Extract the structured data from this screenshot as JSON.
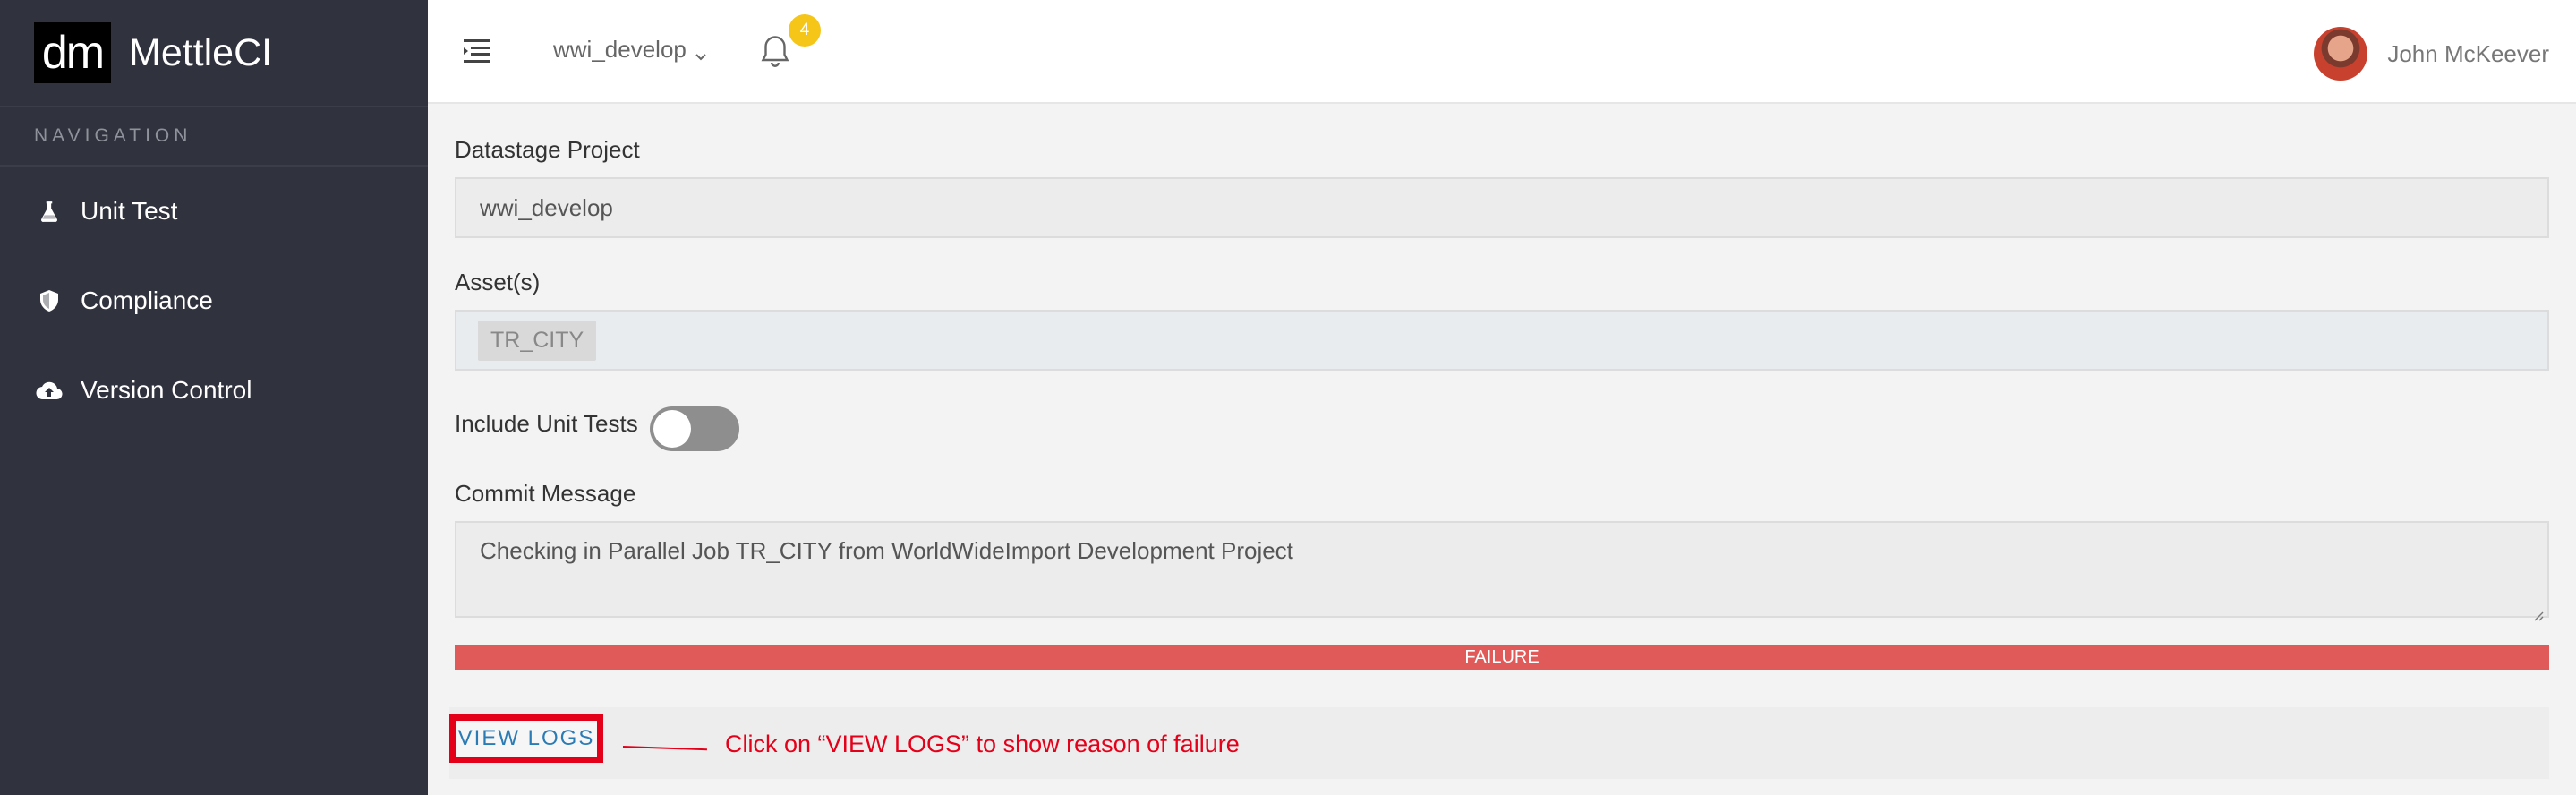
{
  "brand": {
    "logo": "dm",
    "name": "MettleCI"
  },
  "sidebar": {
    "heading": "NAVIGATION",
    "items": [
      {
        "label": "Unit Test",
        "icon": "flask-icon"
      },
      {
        "label": "Compliance",
        "icon": "shield-icon"
      },
      {
        "label": "Version Control",
        "icon": "cloud-upload-icon"
      }
    ]
  },
  "topbar": {
    "project": "wwi_develop",
    "notification_count": "4",
    "user_name": "John McKeever"
  },
  "form": {
    "project_label": "Datastage Project",
    "project_value": "wwi_develop",
    "assets_label": "Asset(s)",
    "assets": [
      "TR_CITY"
    ],
    "unit_tests_label": "Include Unit Tests",
    "unit_tests_enabled": false,
    "commit_label": "Commit Message",
    "commit_message": "Checking in Parallel Job TR_CITY from WorldWideImport Development Project",
    "status": "FAILURE",
    "view_logs_label": "VIEW LOGS",
    "annotation": "Click on “VIEW LOGS” to show reason of failure"
  },
  "colors": {
    "sidebar_bg": "#30323d",
    "failure": "#e15a5a",
    "annotation": "#e5001a",
    "link": "#2b7bb5",
    "badge": "#f5c518"
  }
}
